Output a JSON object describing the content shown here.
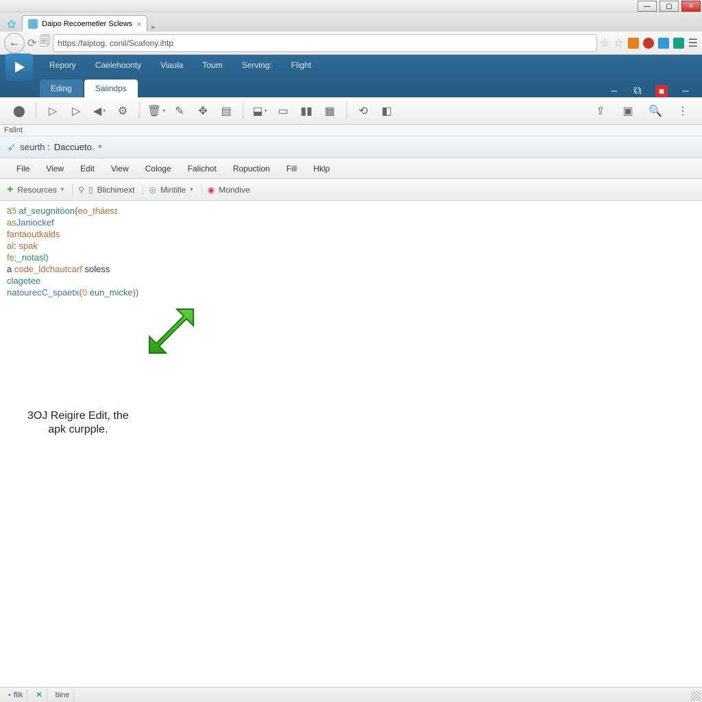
{
  "window": {
    "tab_title": "Daipo Recoemetler Sclews"
  },
  "address": {
    "url": "https:/faiptog. conil/Scafony.ihtp"
  },
  "app_menu": [
    "Repory",
    "Caelehoonty",
    "Viaula",
    "Toum",
    "Serving:",
    "Flight"
  ],
  "app_tabs": {
    "left": "Eding",
    "right": "Saiindps"
  },
  "falint": "Falint",
  "breadcrumb": {
    "label": "seurth :",
    "value": "Daccueto."
  },
  "editor_menu": [
    "File",
    "View",
    "Edit",
    "View",
    "Cologe",
    "Falichot",
    "Ropuction",
    "Fill",
    "Hklp"
  ],
  "resources": {
    "main": "Resources",
    "blichimext": "Blichimext",
    "mintille": "Mintille",
    "mondive": "Mondive"
  },
  "code": [
    {
      "segs": [
        {
          "t": "a̅ɔ̃",
          "c": "kw4"
        },
        {
          "t": " "
        },
        {
          "t": "af_seugnitòon",
          "c": "kw1"
        },
        {
          "t": "{",
          "c": "punct"
        },
        {
          "t": "eo_thäesɪ",
          "c": "kw2"
        }
      ]
    },
    {
      "segs": [
        {
          "t": "as",
          "c": "kw4"
        },
        {
          "t": "Janiockef",
          "c": "kw3"
        }
      ]
    },
    {
      "segs": [
        {
          "t": "fantaoutkalds",
          "c": "kw2"
        }
      ]
    },
    {
      "segs": [
        {
          "t": "al",
          "c": "kw4"
        },
        {
          "t": ": "
        },
        {
          "t": "spak",
          "c": "kw2"
        }
      ]
    },
    {
      "segs": [
        {
          "t": "fe;",
          "c": "kw4"
        },
        {
          "t": "_notasl)",
          "c": "kw1"
        }
      ]
    },
    {
      "segs": [
        {
          "t": "a ",
          "c": ""
        },
        {
          "t": "code_ldchautcarf",
          "c": "kw2"
        },
        {
          "t": " soless"
        }
      ]
    },
    {
      "segs": [
        {
          "t": "clagetee",
          "c": "kw1"
        }
      ]
    },
    {
      "segs": [
        {
          "t": "natourecC_spaetx",
          "c": "kw3"
        },
        {
          "t": "(",
          "c": "punct"
        },
        {
          "t": "0",
          "c": "num"
        },
        {
          "t": " "
        },
        {
          "t": "ėun_micke",
          "c": "kw1"
        },
        {
          "t": "))",
          "c": "punct"
        }
      ]
    }
  ],
  "annotation": {
    "line1": "3OJ Reigire Edit, the",
    "line2": "apk curpple."
  },
  "status": {
    "flik": "flik",
    "bine": "bine"
  }
}
